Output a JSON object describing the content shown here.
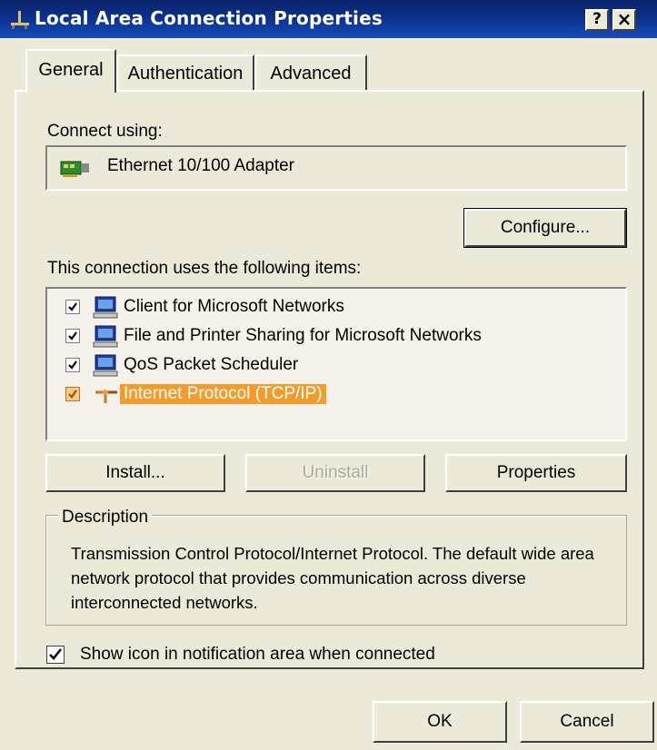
{
  "window": {
    "title": "Local Area Connection Properties",
    "help_button": "?",
    "close_button": "×"
  },
  "tabs": [
    {
      "label": "General",
      "active": true
    },
    {
      "label": "Authentication",
      "active": false
    },
    {
      "label": "Advanced",
      "active": false
    }
  ],
  "connect_using": {
    "label": "Connect using:",
    "adapter": "Ethernet 10/100 Adapter",
    "adapter_icon": "network-card-icon",
    "configure_button": "Configure..."
  },
  "items": {
    "label": "This connection uses the following items:",
    "list": [
      {
        "label": "Client for Microsoft Networks",
        "checked": true,
        "icon": "computer-icon",
        "selected": false
      },
      {
        "label": "File and Printer Sharing for Microsoft Networks",
        "checked": true,
        "icon": "computer-icon",
        "selected": false
      },
      {
        "label": "QoS Packet Scheduler",
        "checked": true,
        "icon": "computer-icon",
        "selected": false
      },
      {
        "label": "Internet Protocol (TCP/IP)",
        "checked": true,
        "icon": "protocol-icon",
        "selected": true
      }
    ],
    "install_button": "Install...",
    "uninstall_button": "Uninstall",
    "properties_button": "Properties"
  },
  "description": {
    "legend": "Description",
    "text": "Transmission Control Protocol/Internet Protocol. The default wide area network protocol that provides communication across diverse interconnected networks."
  },
  "notification": {
    "label": "Show icon in notification area when connected",
    "checked": true
  },
  "footer": {
    "ok_button": "OK",
    "cancel_button": "Cancel"
  },
  "colors": {
    "title_bar": "#0a246a",
    "dialog_bg": "#ece9d8",
    "selection": "#f39c2c"
  }
}
